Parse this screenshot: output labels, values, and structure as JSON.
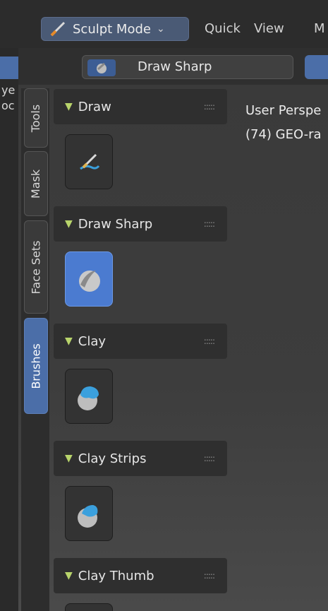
{
  "header": {
    "mode": "Sculpt Mode",
    "menu": [
      "Quick",
      "View",
      "M"
    ]
  },
  "left_strip": {
    "items": [
      "ye",
      "oc"
    ]
  },
  "tool_header": {
    "current_brush": "Draw Sharp"
  },
  "sidebar": {
    "tabs": [
      {
        "label": "Tools",
        "active": false
      },
      {
        "label": "Mask",
        "active": false
      },
      {
        "label": "Face Sets",
        "active": false
      },
      {
        "label": "Brushes",
        "active": true
      }
    ]
  },
  "panels": [
    {
      "title": "Draw",
      "brush_icon": "draw-brush-icon",
      "selected": false
    },
    {
      "title": "Draw Sharp",
      "brush_icon": "draw-sharp-brush-icon",
      "selected": true
    },
    {
      "title": "Clay",
      "brush_icon": "clay-brush-icon",
      "selected": false
    },
    {
      "title": "Clay Strips",
      "brush_icon": "clay-strips-brush-icon",
      "selected": false
    },
    {
      "title": "Clay Thumb",
      "brush_icon": "clay-thumb-brush-icon",
      "selected": false
    }
  ],
  "viewport": {
    "line1": "User Perspe",
    "line2": "(74) GEO-ra"
  },
  "colors": {
    "accent_blue": "#4b6ea8",
    "selected_icon": "#4b7bd0",
    "panel_bg": "#2f2f2f",
    "triangle_green": "#b8d46b"
  }
}
